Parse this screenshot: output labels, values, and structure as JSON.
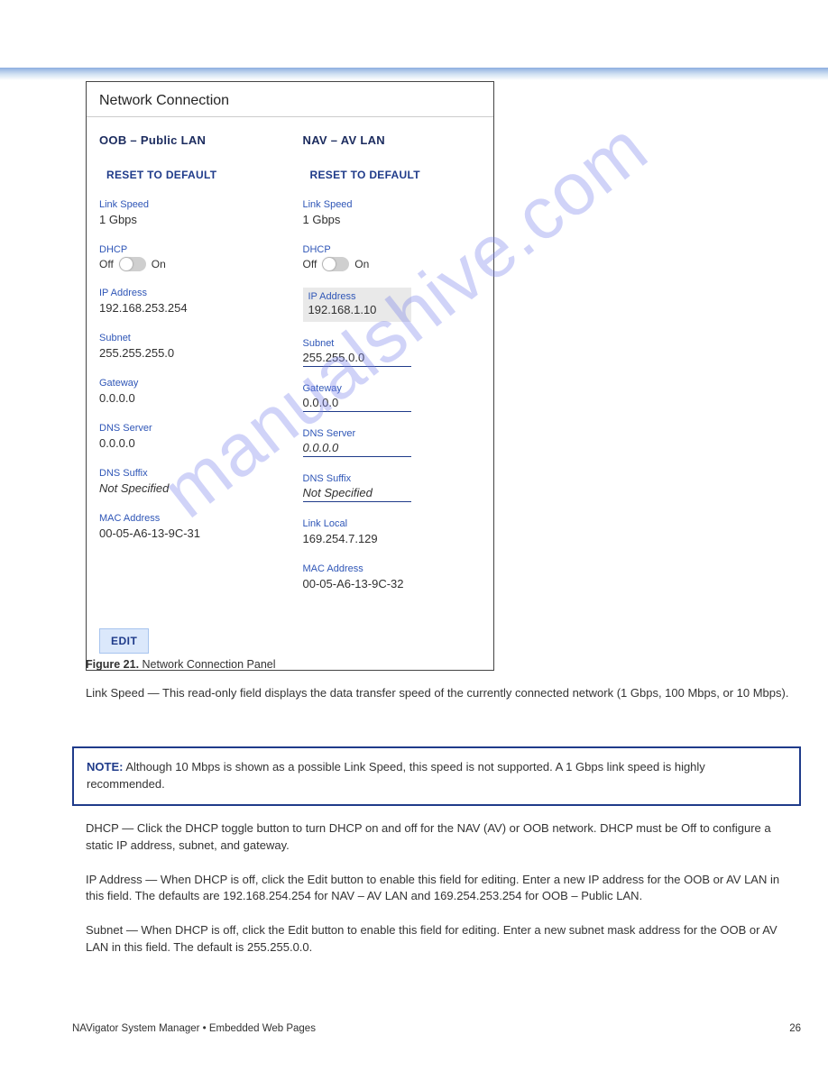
{
  "panel": {
    "title": "Network Connection",
    "edit_label": "EDIT",
    "left": {
      "heading": "OOB – Public LAN",
      "reset": "RESET TO DEFAULT",
      "link_speed_lbl": "Link Speed",
      "link_speed": "1 Gbps",
      "dhcp_lbl": "DHCP",
      "dhcp_off": "Off",
      "dhcp_on": "On",
      "ip_lbl": "IP Address",
      "ip": "192.168.253.254",
      "subnet_lbl": "Subnet",
      "subnet": "255.255.255.0",
      "gateway_lbl": "Gateway",
      "gateway": "0.0.0.0",
      "dns_lbl": "DNS Server",
      "dns": "0.0.0.0",
      "suffix_lbl": "DNS Suffix",
      "suffix": "Not Specified",
      "mac_lbl": "MAC Address",
      "mac": "00-05-A6-13-9C-31"
    },
    "right": {
      "heading": "NAV – AV LAN",
      "reset": "RESET TO DEFAULT",
      "link_speed_lbl": "Link Speed",
      "link_speed": "1 Gbps",
      "dhcp_lbl": "DHCP",
      "dhcp_off": "Off",
      "dhcp_on": "On",
      "ip_lbl": "IP Address",
      "ip": "192.168.1.10",
      "subnet_lbl": "Subnet",
      "subnet": "255.255.0.0",
      "gateway_lbl": "Gateway",
      "gateway": "0.0.0.0",
      "dns_lbl": "DNS Server",
      "dns": "0.0.0.0",
      "suffix_lbl": "DNS Suffix",
      "suffix": "Not Specified",
      "linklocal_lbl": "Link Local",
      "linklocal": "169.254.7.129",
      "mac_lbl": "MAC Address",
      "mac": "00-05-A6-13-9C-32"
    }
  },
  "figcap": {
    "num": "Figure 21.",
    "text": " Network Connection Panel"
  },
  "body1": "Link Speed — This read-only field displays the data transfer speed of the currently connected network (1 Gbps, 100 Mbps, or 10 Mbps).",
  "note": {
    "label": "NOTE:",
    "text": " Although 10 Mbps is shown as a possible Link Speed, this speed is not supported. A 1 Gbps link speed is highly recommended."
  },
  "body2a": "DHCP — Click the DHCP toggle button to turn DHCP on and off for the NAV (AV) or OOB network. DHCP must be Off to configure a static IP address, subnet, and gateway.",
  "body2b": "IP Address — When DHCP is off, click the Edit button to enable this field for editing. Enter a new IP address for the OOB or AV LAN in this field. The defaults are 192.168.254.254 for NAV – AV LAN and 169.254.253.254 for OOB – Public LAN.",
  "body2c": "Subnet — When DHCP is off, click the Edit button to enable this field for editing. Enter a new subnet mask address for the OOB or AV LAN in this field. The default is 255.255.0.0.",
  "footer": {
    "left": "NAVigator System Manager • Embedded Web Pages",
    "right": "26"
  },
  "watermark": "manualshive.com"
}
